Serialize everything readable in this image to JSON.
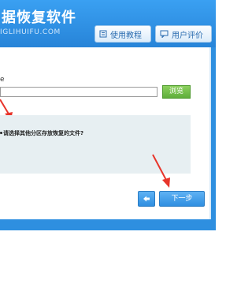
{
  "header": {
    "title": "据恢复软件",
    "url": "IGLIHUIFU.COM",
    "tutorial_label": "使用教程",
    "review_label": "用户评价"
  },
  "form": {
    "path_label": "e",
    "path_value": "",
    "browse_label": "浏览"
  },
  "question": {
    "text": "请选择其他分区存放恢复的文件?"
  },
  "footer": {
    "next_label": "下一步"
  },
  "colors": {
    "header_blue": "#2e8fe0",
    "browse_green": "#6cbc45",
    "annotation_red": "#e8352b"
  },
  "icons": [
    "book-icon",
    "comment-icon",
    "back-arrow-icon",
    "annotation-arrow-icon"
  ]
}
